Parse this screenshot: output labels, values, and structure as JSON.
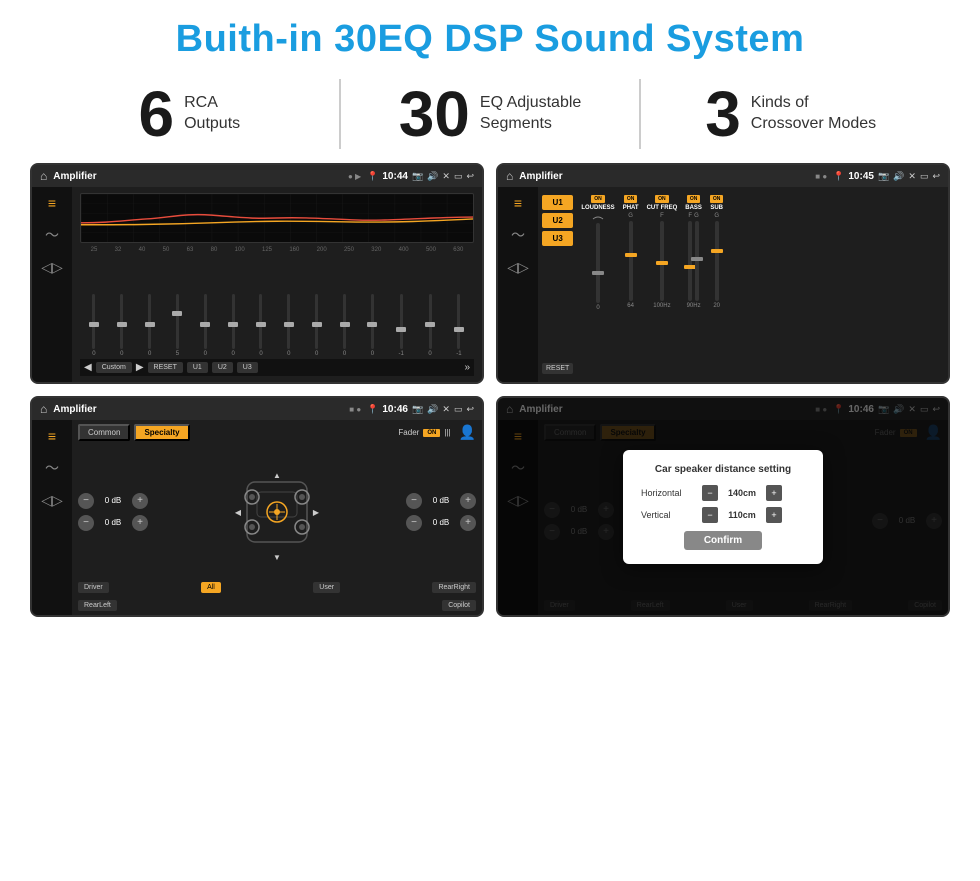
{
  "page": {
    "title": "Buith-in 30EQ DSP Sound System"
  },
  "stats": [
    {
      "number": "6",
      "label": "RCA\nOutputs"
    },
    {
      "number": "30",
      "label": "EQ Adjustable\nSegments"
    },
    {
      "number": "3",
      "label": "Kinds of\nCrossover Modes"
    }
  ],
  "screens": [
    {
      "id": "screen1",
      "statusBar": {
        "title": "Amplifier",
        "time": "10:44"
      },
      "type": "eq",
      "freqLabels": [
        "25",
        "32",
        "40",
        "50",
        "63",
        "80",
        "100",
        "125",
        "160",
        "200",
        "250",
        "320",
        "400",
        "500",
        "630"
      ],
      "sliderValues": [
        "0",
        "0",
        "0",
        "5",
        "0",
        "0",
        "0",
        "0",
        "0",
        "0",
        "0",
        "-1",
        "0",
        "-1"
      ],
      "bottomBtns": [
        "Custom",
        "RESET",
        "U1",
        "U2",
        "U3"
      ]
    },
    {
      "id": "screen2",
      "statusBar": {
        "title": "Amplifier",
        "time": "10:45"
      },
      "type": "amp2",
      "presets": [
        "U1",
        "U2",
        "U3"
      ],
      "channels": [
        {
          "label": "LOUDNESS",
          "on": true
        },
        {
          "label": "PHAT",
          "on": true
        },
        {
          "label": "CUT FREQ",
          "on": true
        },
        {
          "label": "BASS",
          "on": true
        },
        {
          "label": "SUB",
          "on": true
        }
      ]
    },
    {
      "id": "screen3",
      "statusBar": {
        "title": "Amplifier",
        "time": "10:46"
      },
      "type": "fader",
      "tabs": [
        "Common",
        "Specialty"
      ],
      "activeTab": "Specialty",
      "faderLabel": "Fader",
      "faderOn": true,
      "volumes": [
        "0 dB",
        "0 dB",
        "0 dB",
        "0 dB"
      ],
      "bottomLabels": [
        "Driver",
        "All",
        "User",
        "RearRight",
        "RearLeft",
        "Copilot"
      ]
    },
    {
      "id": "screen4",
      "statusBar": {
        "title": "Amplifier",
        "time": "10:46"
      },
      "type": "dialog",
      "tabs": [
        "Common",
        "Specialty"
      ],
      "activeTab": "Specialty",
      "dialog": {
        "title": "Car speaker distance setting",
        "horizontal": "140cm",
        "vertical": "110cm",
        "confirmLabel": "Confirm"
      },
      "bottomLabels": [
        "Driver",
        "RearLeft",
        "User",
        "RearRight",
        "Copilot"
      ]
    }
  ]
}
